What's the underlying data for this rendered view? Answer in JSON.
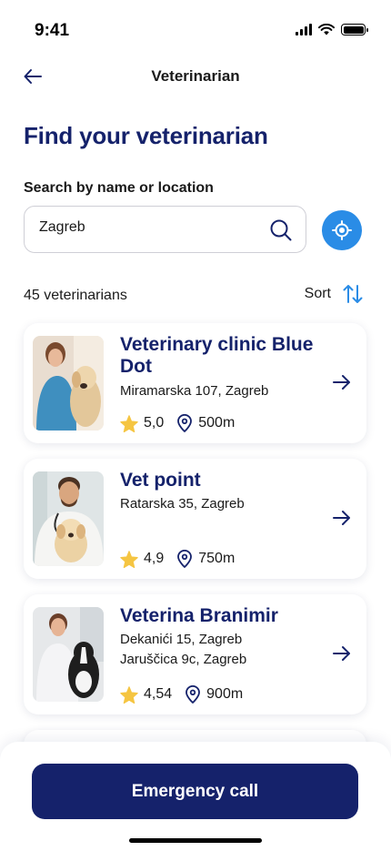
{
  "status_bar": {
    "time": "9:41"
  },
  "header": {
    "title": "Veterinarian",
    "back_icon": "arrow-left-icon"
  },
  "page": {
    "title": "Find your veterinarian"
  },
  "search": {
    "label": "Search by name or location",
    "value": "Zagreb",
    "placeholder": "",
    "search_icon": "search-icon",
    "location_icon": "location-target-icon"
  },
  "results": {
    "count_text": "45 veterinarians",
    "sort_label": "Sort",
    "sort_icon": "sort-arrows-icon"
  },
  "vets": [
    {
      "name": "Veterinary clinic Blue Dot",
      "address": "Miramarska 107, Zagreb",
      "address2": "",
      "rating": "5,0",
      "distance": "500m"
    },
    {
      "name": "Vet point",
      "address": "Ratarska 35, Zagreb",
      "address2": "",
      "rating": "4,9",
      "distance": "750m"
    },
    {
      "name": "Veterina Branimir",
      "address": "Dekanići 15, Zagreb",
      "address2": "Jaruščica 9c, Zagreb",
      "rating": "4,54",
      "distance": "900m"
    }
  ],
  "footer": {
    "emergency_label": "Emergency call"
  },
  "colors": {
    "primary": "#15226b",
    "accent": "#2a8ce6",
    "star": "#f5c542"
  }
}
